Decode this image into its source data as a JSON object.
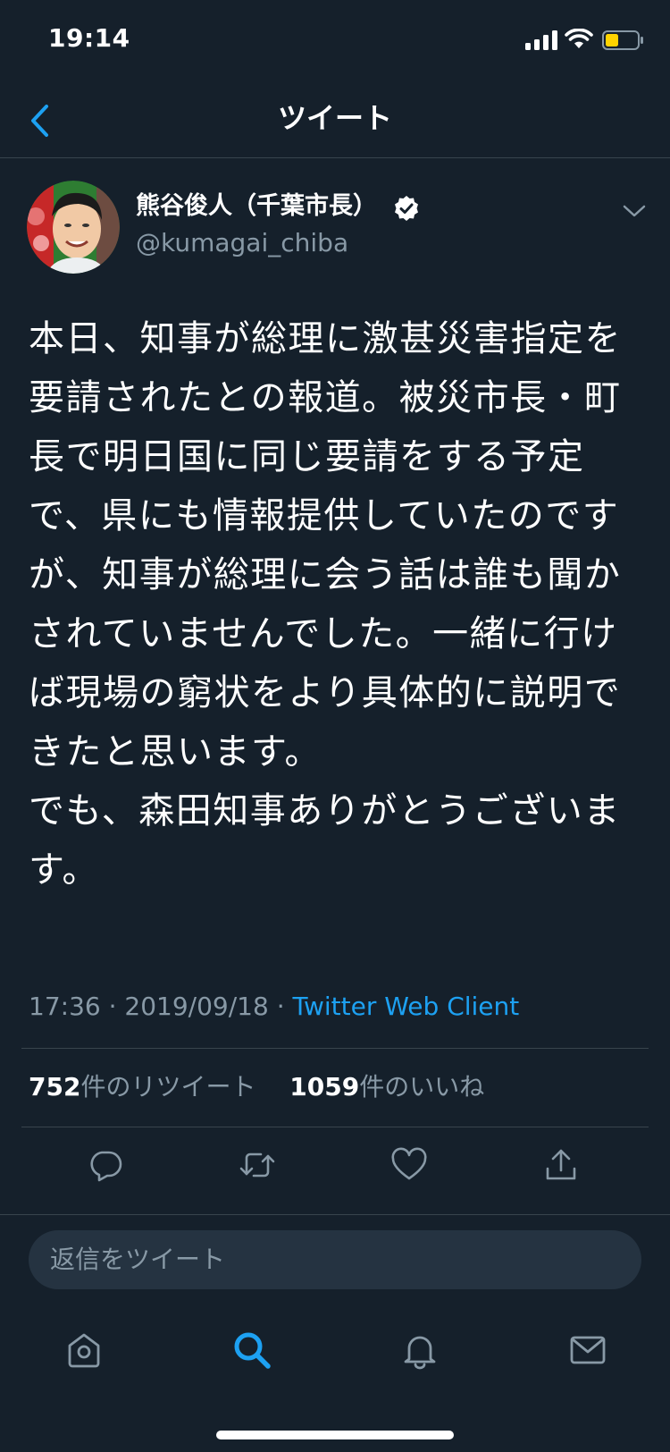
{
  "status_bar": {
    "time": "19:14",
    "signal_icon": "signal-icon",
    "wifi_icon": "wifi-icon",
    "battery_icon": "battery-icon"
  },
  "nav": {
    "title": "ツイート",
    "back_icon": "chevron-left-icon"
  },
  "author": {
    "name": "熊谷俊人（千葉市長）",
    "handle": "@kumagai_chiba",
    "verified": true
  },
  "tweet": {
    "text": "本日、知事が総理に激甚災害指定を要請されたとの報道。被災市長・町長で明日国に同じ要請をする予定で、県にも情報提供していたのですが、知事が総理に会う話は誰も聞かされていませんでした。一緒に行けば現場の窮状をより具体的に説明できたと思います。\nでも、森田知事ありがとうございます。",
    "time": "17:36",
    "date": "2019/09/18",
    "separator": " · ",
    "source": "Twitter Web Client"
  },
  "stats": {
    "retweets": "752",
    "retweets_label": "件のリツイート",
    "likes": "1059",
    "likes_label": "件のいいね"
  },
  "actions": [
    "reply-icon",
    "retweet-icon",
    "heart-icon",
    "share-icon"
  ],
  "reply": {
    "placeholder": "返信をツイート"
  },
  "tabbar": [
    "home-icon",
    "search-icon",
    "bell-icon",
    "mail-icon"
  ],
  "colors": {
    "background": "#15202b",
    "accent": "#1da1f2",
    "muted": "#8899a6",
    "divider": "#38444d",
    "battery": "#ffd400"
  }
}
